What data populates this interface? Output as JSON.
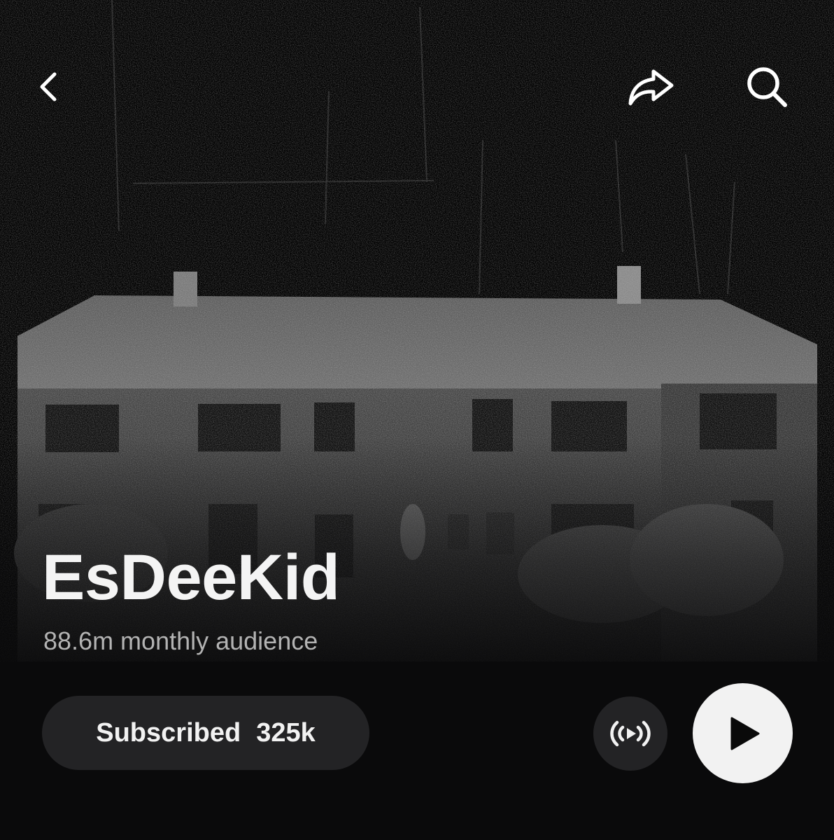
{
  "header": {
    "back_icon": "chevron-left-icon",
    "share_icon": "share-arrow-icon",
    "search_icon": "search-icon"
  },
  "artist": {
    "name": "EsDeeKid",
    "monthly_audience": "88.6m monthly audience"
  },
  "actions": {
    "subscribe_label": "Subscribed",
    "subscriber_count": "325k",
    "radio_icon": "broadcast-play-icon",
    "play_icon": "play-icon"
  },
  "colors": {
    "background": "#0a0a0b",
    "button_dark": "#232325",
    "play_button": "#f2f2f2",
    "secondary_text": "#b3b3b3"
  }
}
